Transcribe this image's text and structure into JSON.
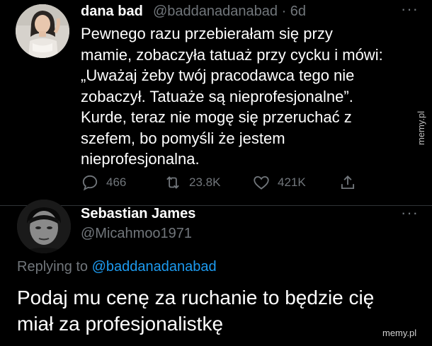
{
  "tweet": {
    "author_name": "dana bad",
    "handle_and_time": "@baddanadanabad · 6d",
    "more_icon": "more-horizontal-icon",
    "text": "Pewnego razu przebierałam się przy\nmamie, zobaczyła tatuaż przy cycku i mówi:\n„Uważaj żeby twój pracodawca tego nie\nzobaczył. Tatuaże są nieprofesjonalne”.\nKurde, teraz nie mogę się przeruchać z\nszefem, bo pomyśli że jestem\nnieprofesjonalna.",
    "actions": {
      "replies": "466",
      "retweets": "23.8K",
      "likes": "421K"
    }
  },
  "reply": {
    "author_name": "Sebastian James",
    "handle": "@Micahmoo1971",
    "replying_prefix": "Replying to",
    "replying_handle": "@baddanadanabad",
    "text": "Podaj mu cenę za ruchanie to będzie cię\nmiał za profesjonalistkę"
  },
  "watermarks": {
    "side": "memy.pl",
    "bottom": "memy.pl"
  },
  "colors": {
    "background": "#000000",
    "text": "#ffffff",
    "secondary": "#71767b",
    "link": "#1d9bf0"
  }
}
